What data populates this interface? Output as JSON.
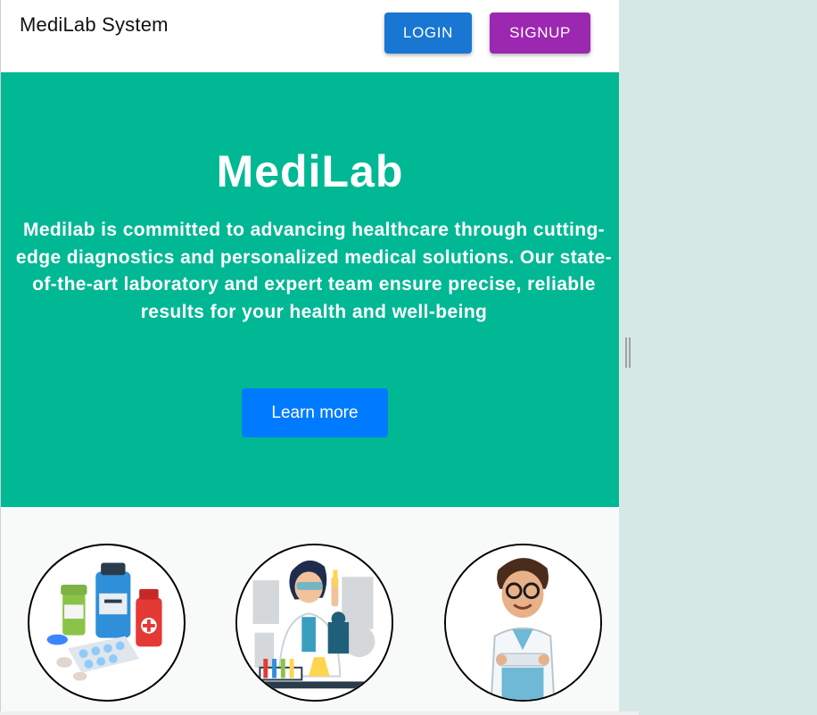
{
  "header": {
    "brand": "MediLab System",
    "login_label": "LOGIN",
    "signup_label": "SIGNUP"
  },
  "hero": {
    "title": "MediLab",
    "description": "Medilab is committed to advancing healthcare through cutting-edge diagnostics and personalized medical solutions. Our state-of-the-art laboratory and expert team ensure precise, reliable results for your health and well-being",
    "cta_label": "Learn more"
  },
  "images": [
    {
      "icon": "medicine-illustration"
    },
    {
      "icon": "lab-scientist-illustration"
    },
    {
      "icon": "doctor-illustration"
    }
  ],
  "colors": {
    "hero_bg": "#00b894",
    "login": "#1976d2",
    "signup": "#9c27b0",
    "cta": "#007bff",
    "page_bg": "#d6e8e6"
  }
}
